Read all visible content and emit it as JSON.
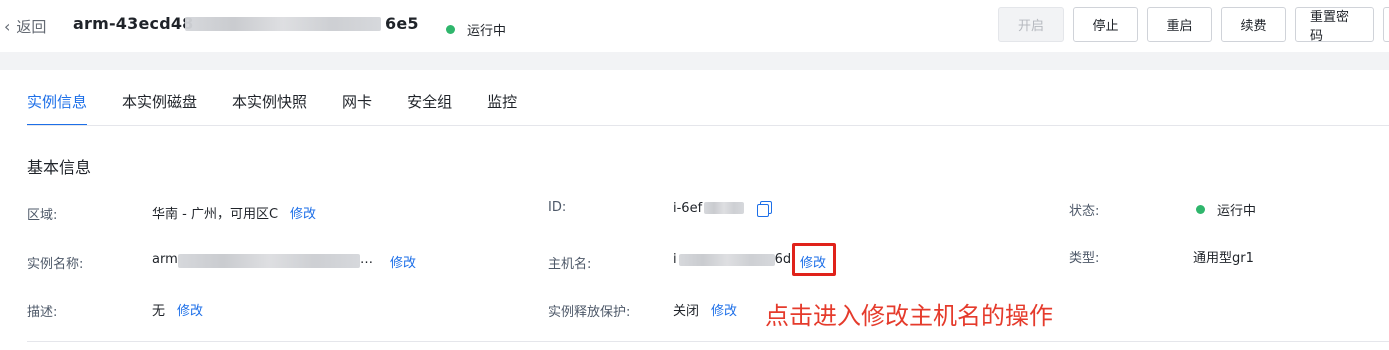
{
  "header": {
    "back_label": "返回",
    "instance_title": "arm-43ecd48",
    "instance_title_tail": "6e5",
    "status": "运行中",
    "status_color": "#2fb66c"
  },
  "actions": {
    "start": "开启",
    "stop": "停止",
    "restart": "重启",
    "renew": "续费",
    "reset_password": "重置密码"
  },
  "tabs": [
    "实例信息",
    "本实例磁盘",
    "本实例快照",
    "网卡",
    "安全组",
    "监控"
  ],
  "section_title": "基本信息",
  "fields": {
    "region": {
      "label": "区域:",
      "value": "华南 - 广州，可用区C",
      "action": "修改"
    },
    "instance_name": {
      "label": "实例名称:",
      "value": "arm",
      "action": "修改"
    },
    "description": {
      "label": "描述:",
      "value": "无",
      "action": "修改"
    },
    "id": {
      "label": "ID:",
      "value": "i-6ef"
    },
    "hostname": {
      "label": "主机名:",
      "value": "i",
      "value_tail": "6d",
      "action": "修改"
    },
    "release_protection": {
      "label": "实例释放保护:",
      "value": "关闭",
      "action": "修改"
    },
    "status": {
      "label": "状态:",
      "value": "运行中"
    },
    "type": {
      "label": "类型:",
      "value": "通用型gr1"
    }
  },
  "annotation": "点击进入修改主机名的操作",
  "colors": {
    "accent": "#1d6fe8",
    "annotation": "#e53b2c",
    "highlight_box": "#e0221a"
  }
}
